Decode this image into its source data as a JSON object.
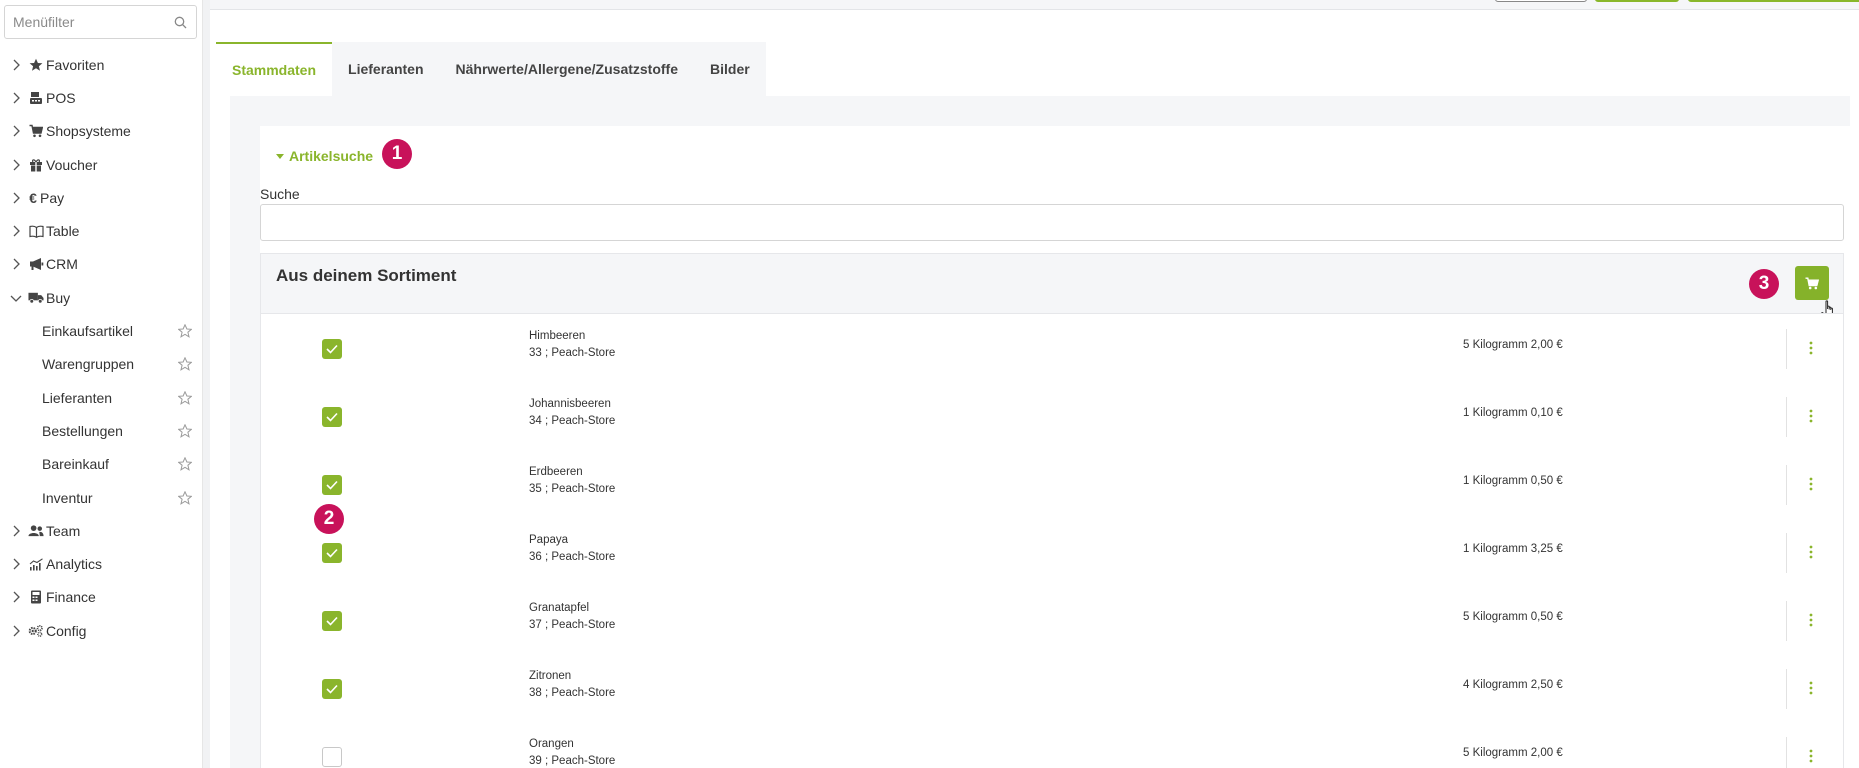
{
  "sidebar": {
    "filter_placeholder": "Menüfilter",
    "items": [
      {
        "label": "Favoriten",
        "icon": "star-icon"
      },
      {
        "label": "POS",
        "icon": "register-icon"
      },
      {
        "label": "Shopsysteme",
        "icon": "cart-icon"
      },
      {
        "label": "Voucher",
        "icon": "gift-icon"
      },
      {
        "label": "Pay",
        "icon": "euro-icon"
      },
      {
        "label": "Table",
        "icon": "book-icon"
      },
      {
        "label": "CRM",
        "icon": "megaphone-icon"
      },
      {
        "label": "Buy",
        "icon": "truck-icon"
      }
    ],
    "buy_children": [
      {
        "label": "Einkaufsartikel"
      },
      {
        "label": "Warengruppen"
      },
      {
        "label": "Lieferanten"
      },
      {
        "label": "Bestellungen"
      },
      {
        "label": "Bareinkauf"
      },
      {
        "label": "Inventur"
      }
    ],
    "items_after": [
      {
        "label": "Team",
        "icon": "users-icon"
      },
      {
        "label": "Analytics",
        "icon": "chart-icon"
      },
      {
        "label": "Finance",
        "icon": "calculator-icon"
      },
      {
        "label": "Config",
        "icon": "cogs-icon"
      }
    ]
  },
  "tabs": [
    {
      "label": "Stammdaten",
      "active": true
    },
    {
      "label": "Lieferanten",
      "active": false
    },
    {
      "label": "Nährwerte/Allergene/Zusatzstoffe",
      "active": false
    },
    {
      "label": "Bilder",
      "active": false
    }
  ],
  "artikelsuche": {
    "label": "Artikelsuche",
    "search_label": "Suche",
    "search_value": ""
  },
  "badges": {
    "b1": "1",
    "b2": "2",
    "b3": "3"
  },
  "sortiment": {
    "title": "Aus deinem Sortiment",
    "rows": [
      {
        "name": "Himbeeren",
        "sub": "33 ; Peach-Store",
        "price": "5 Kilogramm 2,00 €",
        "checked": true
      },
      {
        "name": "Johannisbeeren",
        "sub": "34 ; Peach-Store",
        "price": "1 Kilogramm 0,10 €",
        "checked": true
      },
      {
        "name": "Erdbeeren",
        "sub": "35 ; Peach-Store",
        "price": "1 Kilogramm 0,50 €",
        "checked": true
      },
      {
        "name": "Papaya",
        "sub": "36 ; Peach-Store",
        "price": "1 Kilogramm 3,25 €",
        "checked": true
      },
      {
        "name": "Granatapfel",
        "sub": "37 ; Peach-Store",
        "price": "5 Kilogramm 0,50 €",
        "checked": true
      },
      {
        "name": "Zitronen",
        "sub": "38 ; Peach-Store",
        "price": "4 Kilogramm 2,50 €",
        "checked": true
      },
      {
        "name": "Orangen",
        "sub": "39 ; Peach-Store",
        "price": "5 Kilogramm 2,00 €",
        "checked": false
      }
    ]
  },
  "colors": {
    "accent": "#8ab52c",
    "badge": "#c8125a"
  }
}
